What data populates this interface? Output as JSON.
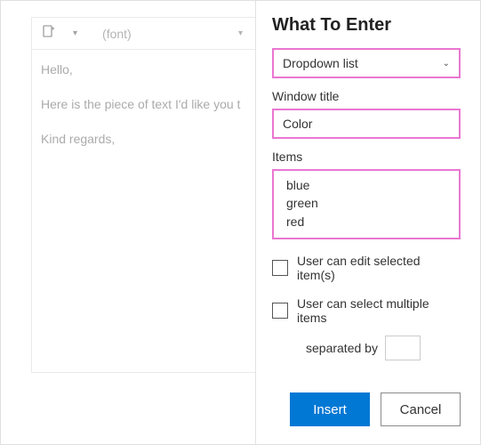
{
  "editor": {
    "toolbar": {
      "font_placeholder": "(font)"
    },
    "paragraphs": [
      "Hello,",
      "Here is the piece of text I'd like you t",
      "Kind regards,"
    ]
  },
  "panel": {
    "title": "What To Enter",
    "type_field": {
      "value": "Dropdown list"
    },
    "window_title": {
      "label": "Window title",
      "value": "Color"
    },
    "items": {
      "label": "Items",
      "lines": [
        "blue",
        "green",
        "red"
      ]
    },
    "check_edit": {
      "label": "User can edit selected item(s)"
    },
    "check_multi": {
      "label": "User can select multiple items"
    },
    "separator": {
      "label": "separated by",
      "value": ""
    },
    "buttons": {
      "insert": "Insert",
      "cancel": "Cancel"
    }
  }
}
